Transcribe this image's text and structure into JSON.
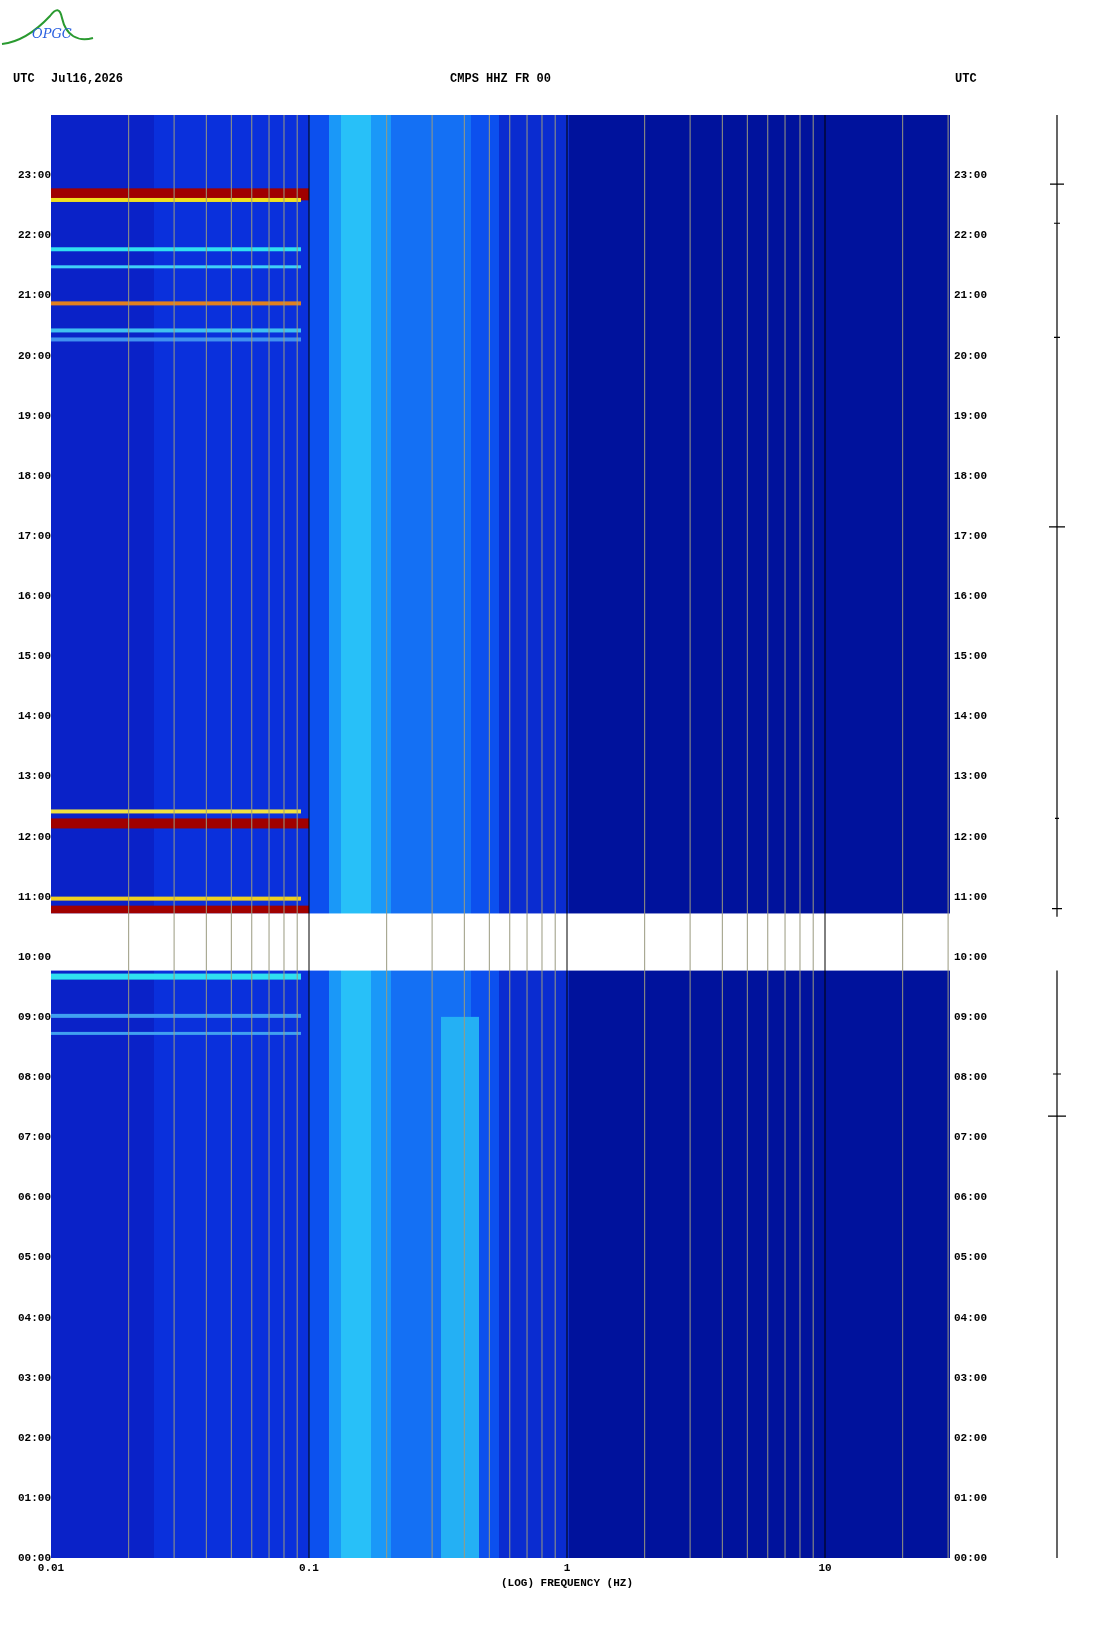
{
  "logo": {
    "text": "OPGC"
  },
  "header": {
    "left_zone": "UTC",
    "date": "Jul16,2026",
    "station": "CMPS HHZ FR 00",
    "right_zone": "UTC"
  },
  "left_time_labels": [
    "23:00",
    "22:00",
    "21:00",
    "20:00",
    "19:00",
    "18:00",
    "17:00",
    "16:00",
    "15:00",
    "14:00",
    "13:00",
    "12:00",
    "11:00",
    "10:00",
    "09:00",
    "08:00",
    "07:00",
    "06:00",
    "05:00",
    "04:00",
    "03:00",
    "02:00",
    "01:00",
    "00:00"
  ],
  "right_time_labels": [
    "23:00",
    "22:00",
    "21:00",
    "20:00",
    "19:00",
    "18:00",
    "17:00",
    "16:00",
    "15:00",
    "14:00",
    "13:00",
    "12:00",
    "11:00",
    "10:00",
    "09:00",
    "08:00",
    "07:00",
    "06:00",
    "05:00",
    "04:00",
    "03:00",
    "02:00",
    "01:00",
    "00:00"
  ],
  "frequency_axis": {
    "ticks": [
      "0.01",
      "0.1",
      "1",
      "10"
    ],
    "label": "(LOG) FREQUENCY (HZ)"
  }
}
